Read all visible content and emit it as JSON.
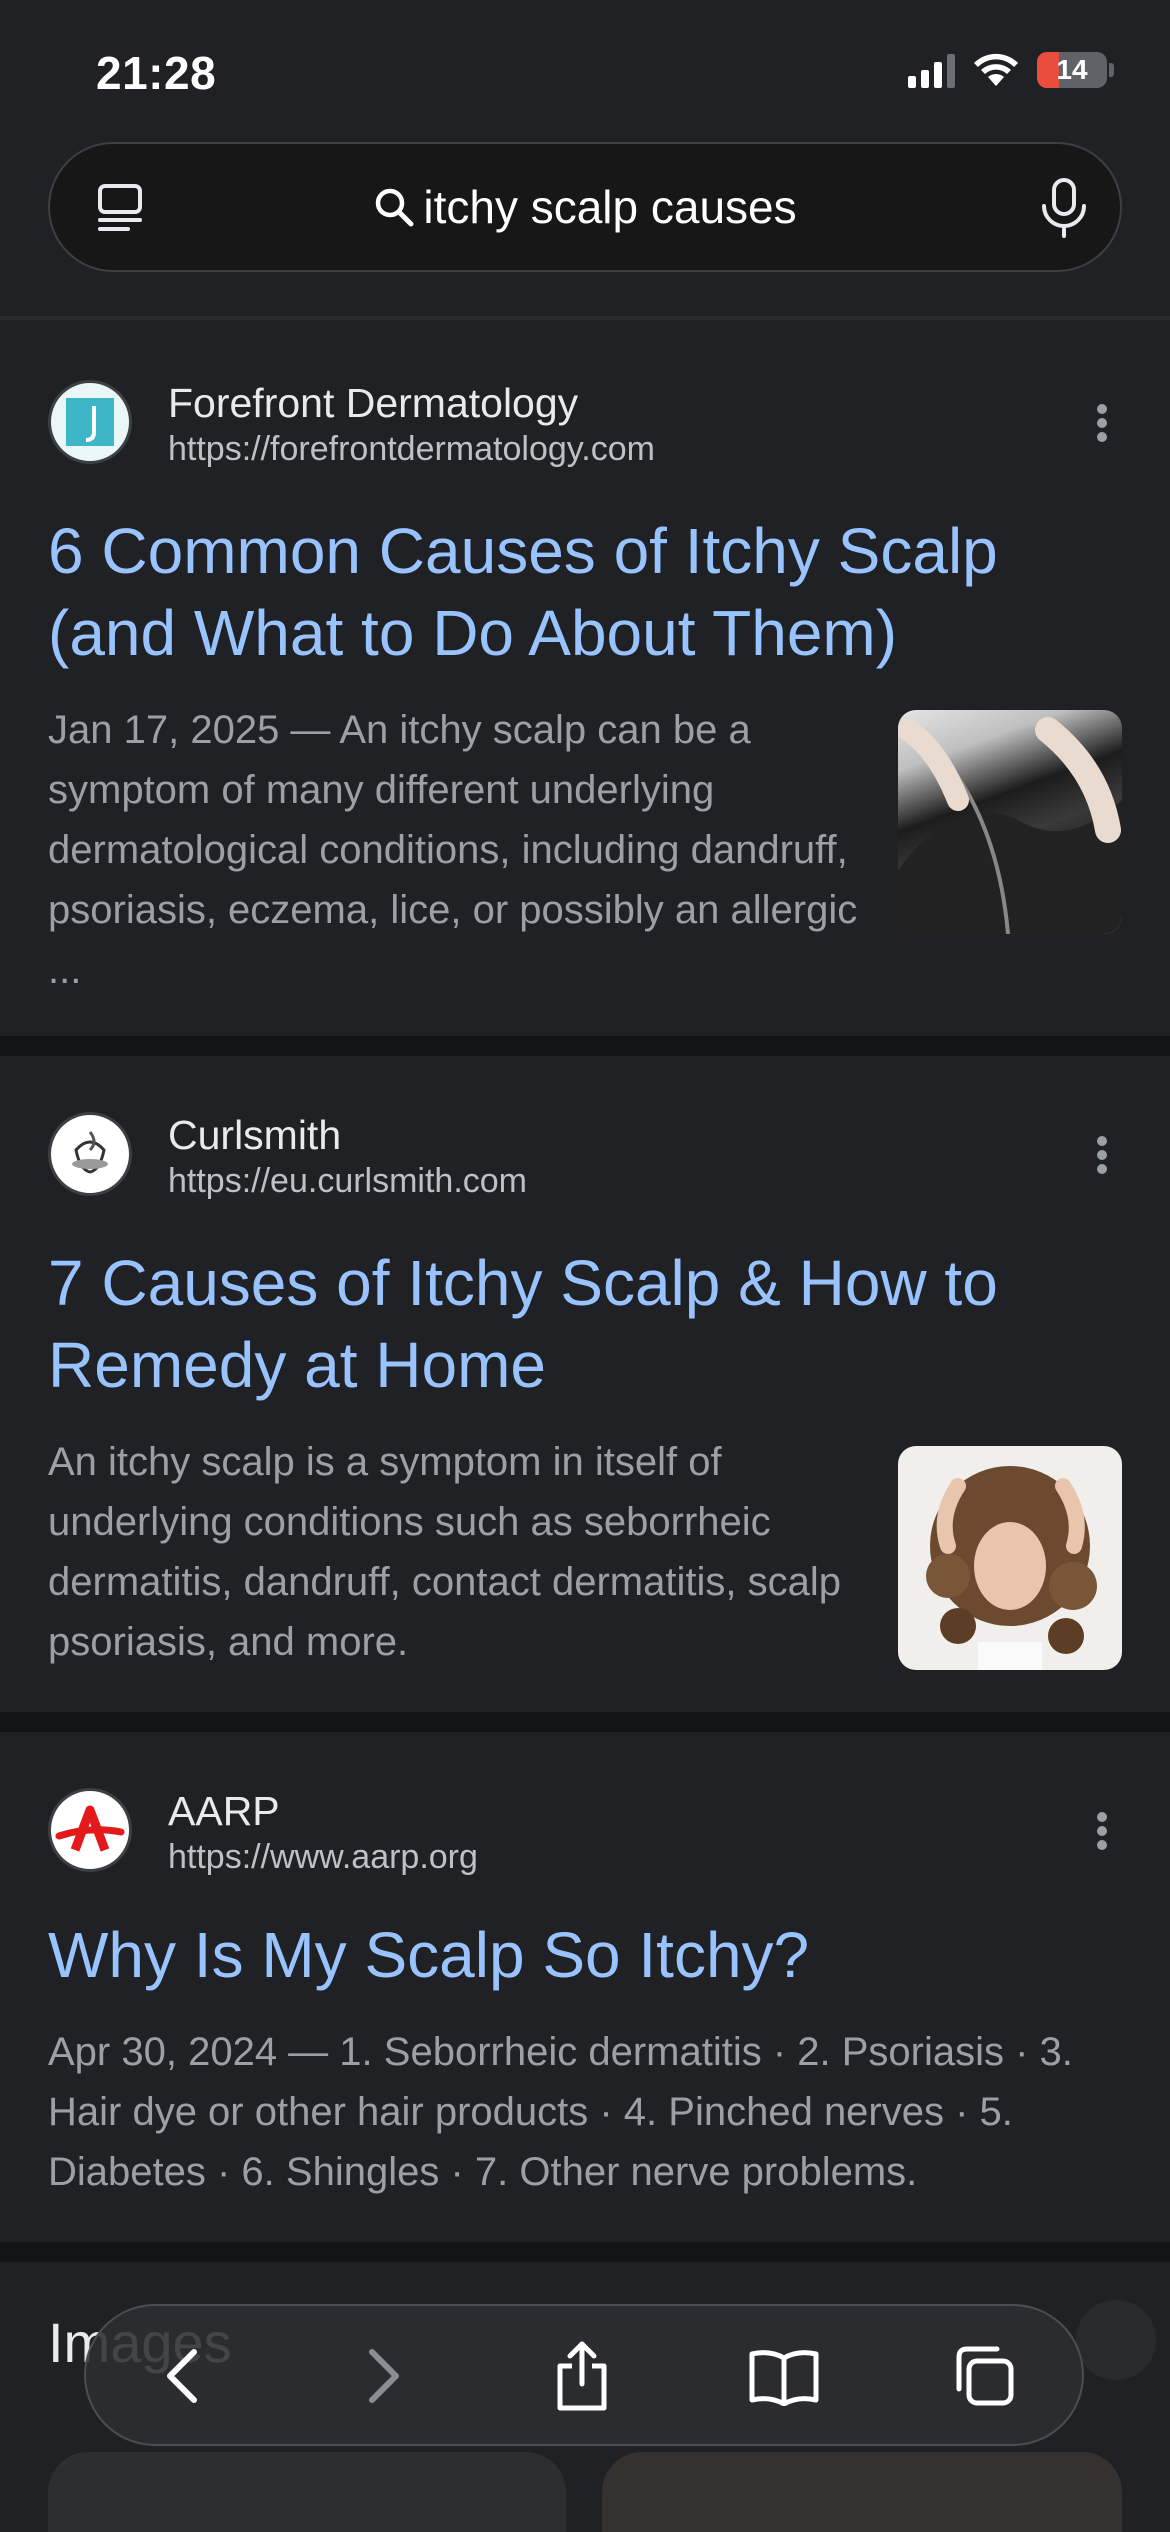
{
  "status_bar": {
    "time": "21:28",
    "battery": "14"
  },
  "search": {
    "query": "itchy scalp causes"
  },
  "results": [
    {
      "site_name": "Forefront Dermatology",
      "url": "https://forefrontdermatology.com",
      "title": "6 Common Causes of Itchy Scalp (and What to Do About Them)",
      "date": "Jan 17, 2025",
      "snippet": "An itchy scalp can be a symptom of many different underlying dermatological conditions, including dandruff, psoriasis, eczema, lice, or possibly an allergic ...",
      "favicon": "forefront-logo",
      "thumbnail": "hair-scratching-photo"
    },
    {
      "site_name": "Curlsmith",
      "url": "https://eu.curlsmith.com",
      "title": "7 Causes of Itchy Scalp & How to Remedy at Home",
      "date": "",
      "snippet": "An itchy scalp is a symptom in itself of underlying conditions such as seborrheic dermatitis, dandruff, contact dermatitis, scalp psoriasis, and more.",
      "favicon": "curlsmith-logo",
      "thumbnail": "curly-hair-woman-photo"
    },
    {
      "site_name": "AARP",
      "url": "https://www.aarp.org",
      "title": "Why Is My Scalp So Itchy?",
      "date": "Apr 30, 2024",
      "snippet": "1. Seborrheic dermatitis · 2. Psoriasis · 3. Hair dye or other hair products · 4. Pinched nerves · 5. Diabetes · 6. Shingles · 7. Other nerve problems.",
      "favicon": "aarp-logo"
    }
  ],
  "images_section": {
    "heading": "Images"
  },
  "toolbar": {
    "icons": [
      "back-icon",
      "forward-icon",
      "share-icon",
      "bookmarks-icon",
      "tabs-icon"
    ]
  },
  "colors": {
    "background": "#202124",
    "link": "#99c3ff",
    "snippet": "#9aa0a6",
    "battery_low": "#eb4d3d"
  }
}
